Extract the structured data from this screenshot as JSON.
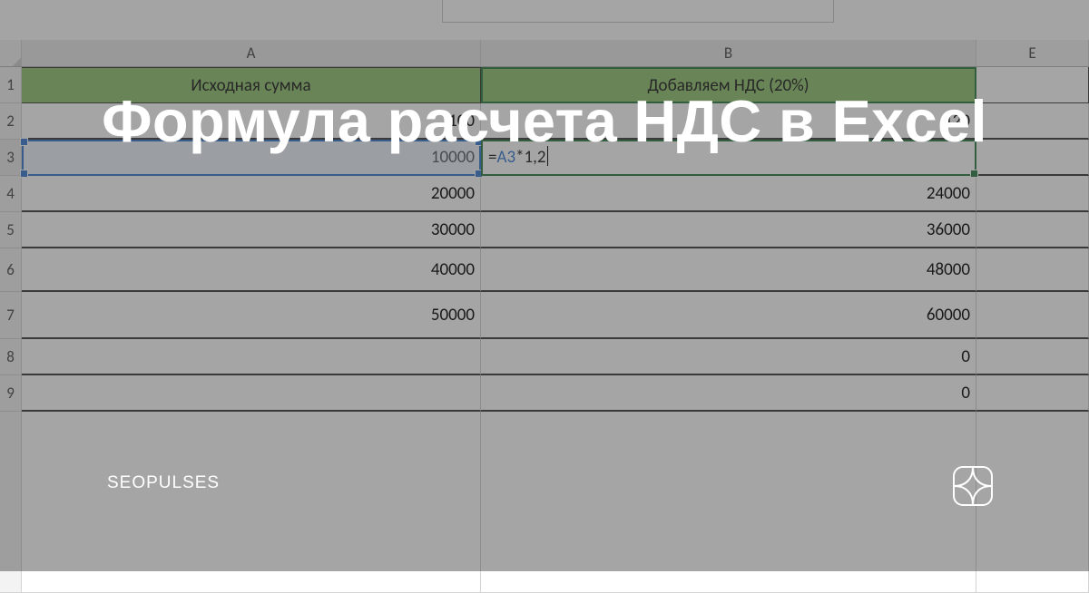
{
  "columns": {
    "A": "A",
    "B": "B",
    "E": "E"
  },
  "header_row": {
    "a": "Исходная сумма",
    "b": "Добавляем НДС (20%)"
  },
  "rows": [
    {
      "n": "1"
    },
    {
      "n": "2",
      "a": "100",
      "b": "120"
    },
    {
      "n": "3",
      "a": "10000",
      "b_formula_ref": "A3",
      "b_formula_tail": "*1,2"
    },
    {
      "n": "4",
      "a": "20000",
      "b": "24000"
    },
    {
      "n": "5",
      "a": "30000",
      "b": "36000"
    },
    {
      "n": "6",
      "a": "40000",
      "b": "48000"
    },
    {
      "n": "7",
      "a": "50000",
      "b": "60000"
    },
    {
      "n": "8",
      "a": "",
      "b": "0"
    },
    {
      "n": "9",
      "a": "",
      "b": "0"
    }
  ],
  "overlay": {
    "headline": "Формула расчета НДС в Excel",
    "brand": "SEOPULSES"
  }
}
